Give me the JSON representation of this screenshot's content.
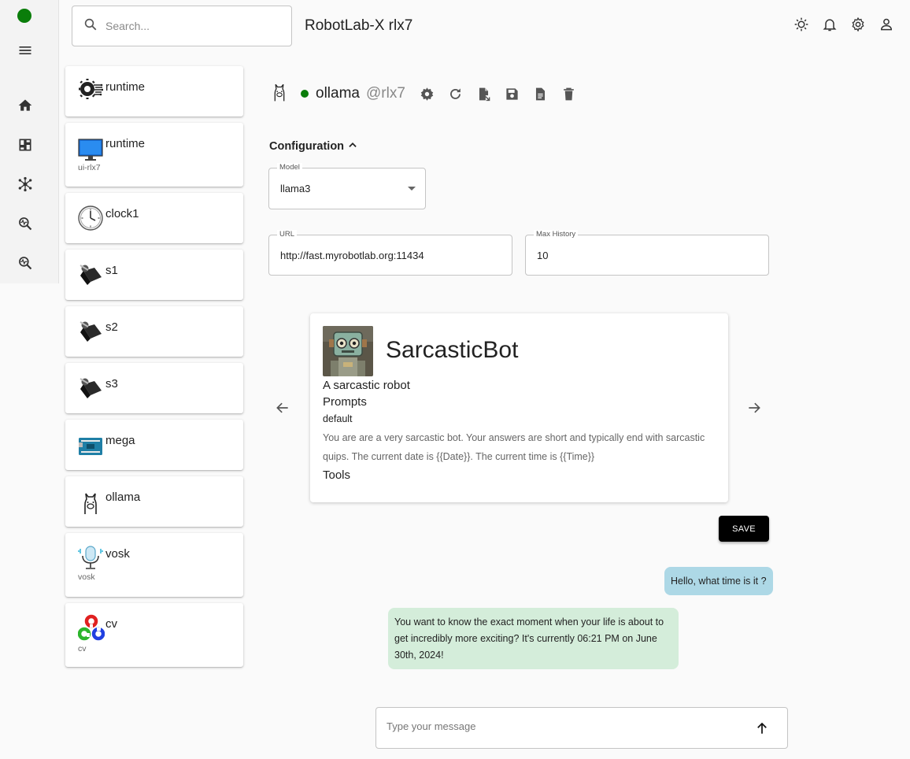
{
  "app": {
    "title": "RobotLab-X rlx7",
    "connection_color": "#0a7d0a"
  },
  "search": {
    "placeholder": "Search..."
  },
  "rail": {
    "items": [
      "menu-icon",
      "home-icon",
      "dashboard-icon",
      "network-icon",
      "search-pulse-icon",
      "search-pulse-icon"
    ]
  },
  "topbar": {
    "icons": [
      "theme-icon",
      "bell-icon",
      "gear-icon",
      "user-icon"
    ]
  },
  "services": [
    {
      "name": "runtime",
      "sub": "",
      "icon": "runtime-gear-icon"
    },
    {
      "name": "runtime",
      "sub": "ui-rlx7",
      "icon": "monitor-icon"
    },
    {
      "name": "clock1",
      "sub": "",
      "icon": "clock-icon"
    },
    {
      "name": "s1",
      "sub": "",
      "icon": "servo-icon"
    },
    {
      "name": "s2",
      "sub": "",
      "icon": "servo-icon"
    },
    {
      "name": "s3",
      "sub": "",
      "icon": "servo-icon"
    },
    {
      "name": "mega",
      "sub": "",
      "icon": "arduino-icon"
    },
    {
      "name": "ollama",
      "sub": "",
      "icon": "llama-icon"
    },
    {
      "name": "vosk",
      "sub": "vosk",
      "icon": "microphone-icon"
    },
    {
      "name": "cv",
      "sub": "cv",
      "icon": "opencv-icon"
    }
  ],
  "service": {
    "name": "ollama",
    "at": "@rlx7",
    "status_color": "#0a7d0a",
    "actions": [
      "gear-icon",
      "refresh-icon",
      "export-icon",
      "save-icon",
      "document-icon",
      "delete-icon"
    ]
  },
  "config": {
    "title": "Configuration",
    "model": {
      "label": "Model",
      "value": "llama3"
    },
    "url": {
      "label": "URL",
      "value": "http://fast.myrobotlab.org:11434"
    },
    "max_history": {
      "label": "Max History",
      "value": "10"
    }
  },
  "persona": {
    "name": "SarcasticBot",
    "description": "A sarcastic robot",
    "prompts_label": "Prompts",
    "prompt_name": "default",
    "prompt_text": "You are are a very sarcastic bot. Your answers are short and typically end with sarcastic quips. The current date is {{Date}}. The current time is {{Time}}",
    "tools_label": "Tools"
  },
  "save_label": "SAVE",
  "chat": {
    "user_message": "Hello, what time is it ?",
    "bot_message": "You want to know the exact moment when your life is about to get incredibly more exciting? It's currently 06:21 PM on June 30th, 2024!",
    "user_color": "#add8e6",
    "bot_color": "#d4edda",
    "input_placeholder": "Type your message"
  }
}
